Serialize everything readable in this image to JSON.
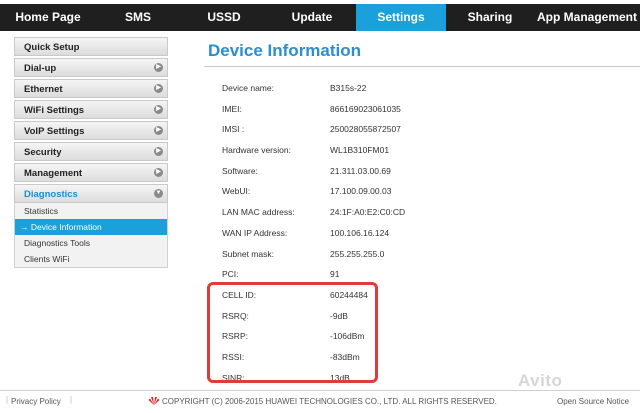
{
  "nav": {
    "tabs": [
      "Home Page",
      "SMS",
      "USSD",
      "Update",
      "Settings",
      "Sharing",
      "App Management"
    ],
    "active": "Settings"
  },
  "sidebar": {
    "items": [
      "Quick Setup",
      "Dial-up",
      "Ethernet",
      "WiFi Settings",
      "VoIP Settings",
      "Security",
      "Management",
      "Diagnostics"
    ],
    "diagnostics_sub": [
      "Statistics",
      "Device Information",
      "Diagnostics Tools",
      "Clients WiFi"
    ],
    "active_sub": "Device Information"
  },
  "content": {
    "title": "Device Information",
    "rows": [
      {
        "label": "Device name:",
        "value": "B315s-22"
      },
      {
        "label": "IMEI:",
        "value": "866169023061035"
      },
      {
        "label": "IMSI :",
        "value": "250028055872507"
      },
      {
        "label": "Hardware version:",
        "value": "WL1B310FM01"
      },
      {
        "label": "Software:",
        "value": "21.311.03.00.69"
      },
      {
        "label": "WebUI:",
        "value": "17.100.09.00.03"
      },
      {
        "label": "LAN MAC address:",
        "value": "24:1F:A0:E2:C0:CD"
      },
      {
        "label": "WAN IP Address:",
        "value": "100.106.16.124"
      },
      {
        "label": "Subnet mask:",
        "value": "255.255.255.0"
      },
      {
        "label": "PCI:",
        "value": "91"
      },
      {
        "label": "CELL ID:",
        "value": "60244484"
      },
      {
        "label": "RSRQ:",
        "value": "-9dB"
      },
      {
        "label": "RSRP:",
        "value": "-106dBm"
      },
      {
        "label": "RSSI:",
        "value": "-83dBm"
      },
      {
        "label": "SINR:",
        "value": "13dB"
      }
    ]
  },
  "footer": {
    "privacy": "Privacy Policy",
    "copyright": "COPYRIGHT (C) 2006-2015 HUAWEI TECHNOLOGIES CO., LTD. ALL RIGHTS RESERVED.",
    "open_source": "Open Source Notice"
  },
  "watermark": "Avito",
  "colors": {
    "accent": "#1aa0db",
    "title": "#2a8ecf",
    "highlight": "#e03a3a",
    "navbar": "#1f1f1f"
  }
}
